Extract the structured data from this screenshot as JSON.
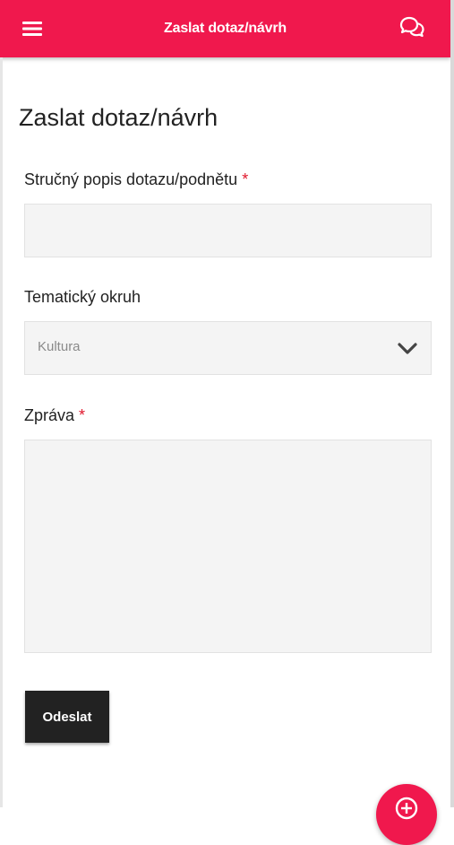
{
  "app_bar": {
    "title": "Zaslat dotaz/návrh",
    "menu_icon": "menu-icon",
    "chat_icon": "chat-icon",
    "color": "#f0184d"
  },
  "page": {
    "title": "Zaslat dotaz/návrh"
  },
  "form": {
    "subject": {
      "label": "Stručný popis dotazu/podnětu",
      "required_mark": "*",
      "value": ""
    },
    "topic": {
      "label": "Tematický okruh",
      "selected": "Kultura"
    },
    "message": {
      "label": "Zpráva",
      "required_mark": "*",
      "value": ""
    },
    "submit_label": "Odeslat"
  },
  "fab": {
    "icon": "plus-icon"
  }
}
